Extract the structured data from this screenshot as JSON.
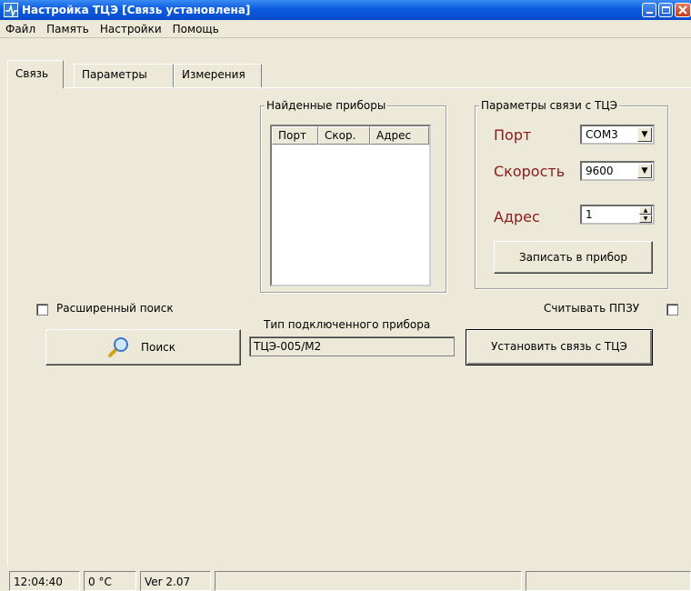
{
  "window": {
    "title": "Настройка ТЦЭ [Связь установлена]",
    "app_icon": "app-icon",
    "buttons": [
      "minimize-icon",
      "maximize-icon",
      "close-icon"
    ]
  },
  "menu": {
    "items": [
      "Файл",
      "Память",
      "Настройки",
      "Помощь"
    ]
  },
  "tabs": [
    "Связь",
    "Параметры",
    "Измерения"
  ],
  "found_devices": {
    "title": "Найденные приборы",
    "columns": [
      "Порт",
      "Скор.",
      "Адрес"
    ],
    "rows": []
  },
  "connection_params": {
    "title": "Параметры связи с ТЦЭ",
    "port_label": "Порт",
    "port_value": "COM3",
    "speed_label": "Скорость",
    "speed_value": "9600",
    "address_label": "Адрес",
    "address_value": "1",
    "write_button": "Записать в прибор",
    "label_color": "#8b1a1a"
  },
  "search": {
    "extended_label": "Расширенный поиск",
    "button_label": "Поиск",
    "icon": "magnifier-icon"
  },
  "device_type": {
    "label": "Тип подключенного прибора",
    "value": "ТЦЭ-005/М2"
  },
  "eeprom": {
    "label": "Считывать ППЗУ"
  },
  "connect_button": "Установить связь с ТЦЭ",
  "status": {
    "time": "12:04:40",
    "temperature": "0 °C",
    "version": "Ver 2.07"
  }
}
